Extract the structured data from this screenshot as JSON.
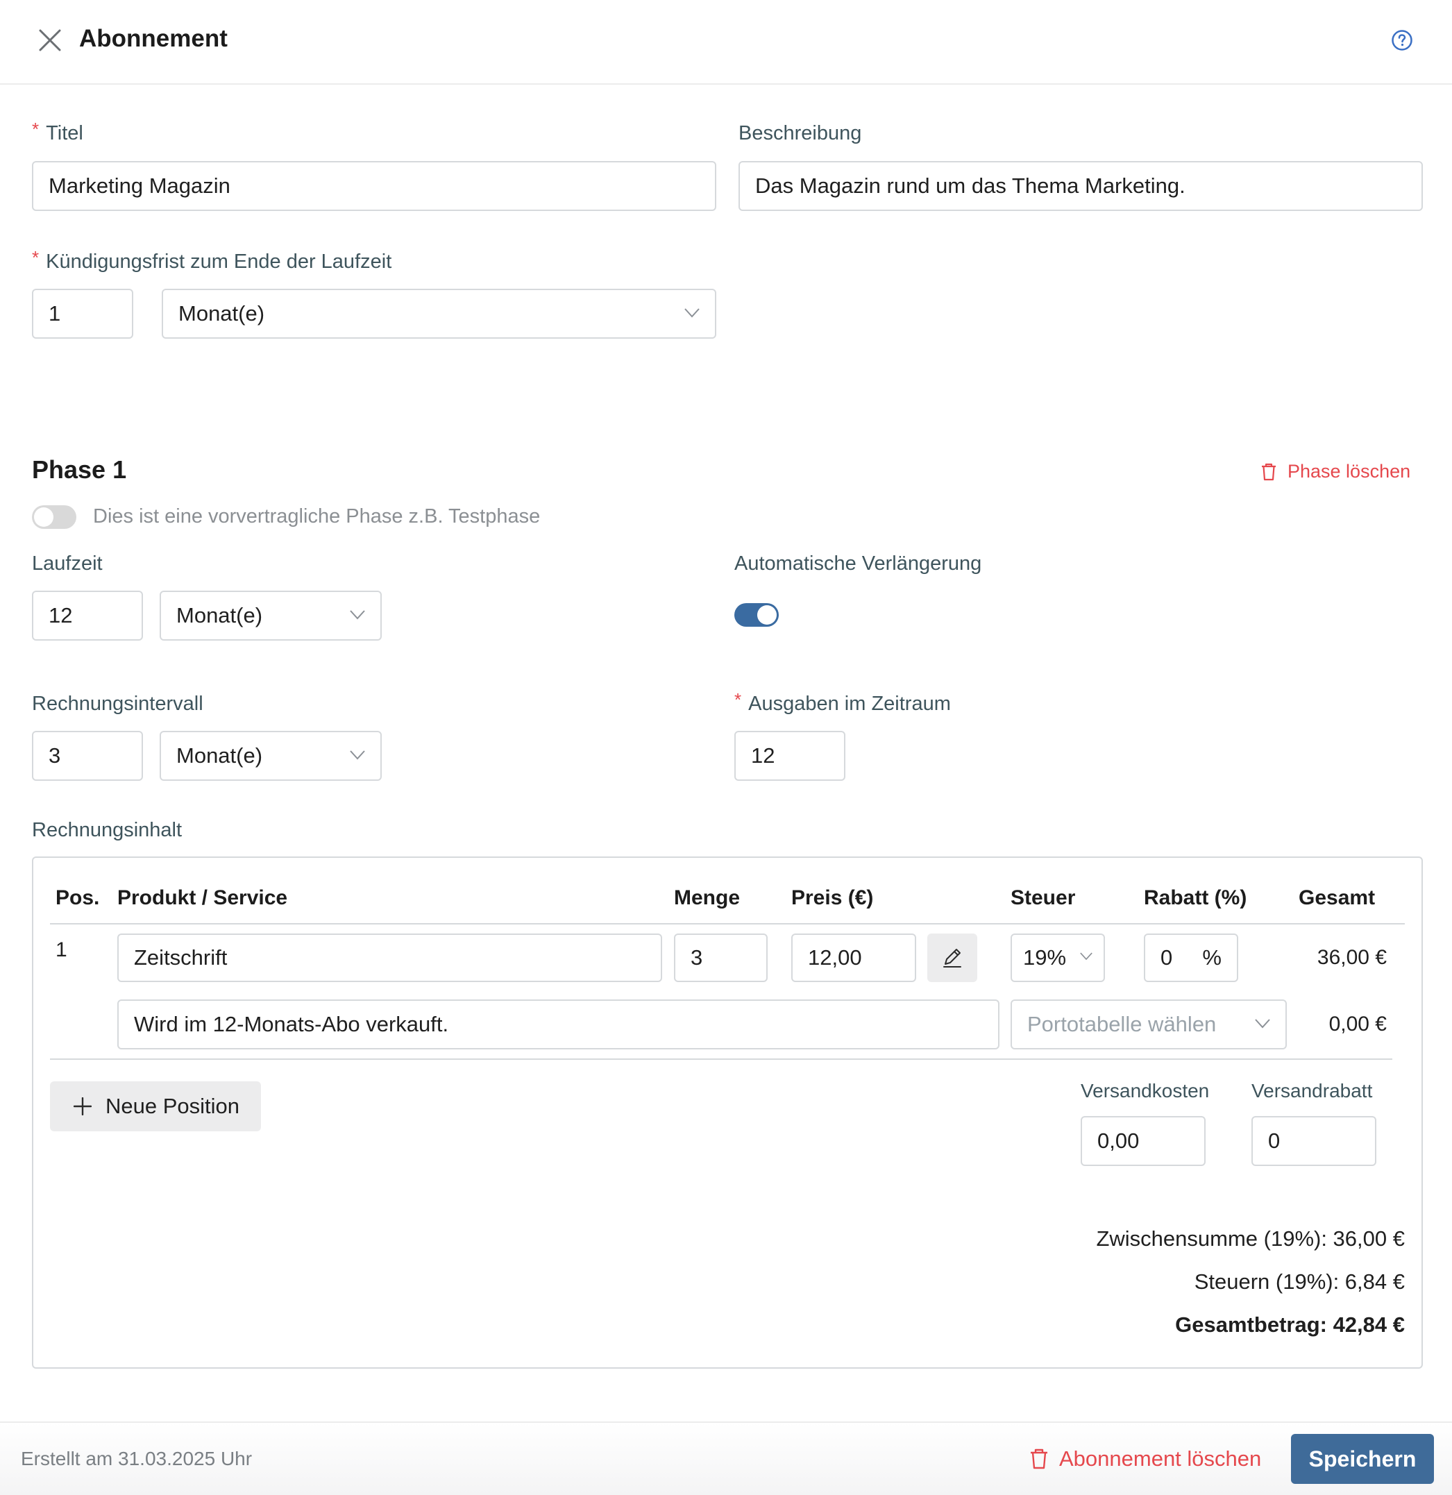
{
  "header": {
    "title": "Abonnement",
    "close_icon": "close-icon",
    "help_icon": "help-icon"
  },
  "form": {
    "titel": {
      "label": "Titel",
      "value": "Marketing Magazin",
      "required": true
    },
    "beschreibung": {
      "label": "Beschreibung",
      "value": "Das Magazin rund um das Thema Marketing."
    },
    "kuendigungsfrist": {
      "label": "Kündigungsfrist zum Ende der Laufzeit",
      "value": "1",
      "unit": "Monat(e)",
      "required": true
    }
  },
  "phase": {
    "title": "Phase 1",
    "delete_label": "Phase löschen",
    "precontract_toggle": {
      "label": "Dies ist eine vorvertragliche Phase z.B. Testphase",
      "on": false
    },
    "laufzeit": {
      "label": "Laufzeit",
      "value": "12",
      "unit": "Monat(e)"
    },
    "auto_renew": {
      "label": "Automatische Verlängerung",
      "on": true
    },
    "rechnungsintervall": {
      "label": "Rechnungsintervall",
      "value": "3",
      "unit": "Monat(e)"
    },
    "ausgaben": {
      "label": "Ausgaben im Zeitraum",
      "value": "12",
      "required": true
    }
  },
  "invoice": {
    "label": "Rechnungsinhalt",
    "headers": {
      "pos": "Pos.",
      "product": "Produkt / Service",
      "menge": "Menge",
      "preis": "Preis (€)",
      "steuer": "Steuer",
      "rabatt": "Rabatt (%)",
      "gesamt": "Gesamt"
    },
    "rows": [
      {
        "pos": "1",
        "product": "Zeitschrift",
        "menge": "3",
        "preis": "12,00",
        "steuer": "19%",
        "rabatt": "0",
        "rabatt_unit": "%",
        "gesamt": "36,00 €",
        "description": "Wird im 12-Monats-Abo verkauft.",
        "porto_placeholder": "Portotabelle wählen",
        "porto_total": "0,00 €"
      }
    ],
    "new_position_label": "Neue Position",
    "versandkosten": {
      "label": "Versandkosten",
      "value": "0,00"
    },
    "versandrabatt": {
      "label": "Versandrabatt",
      "value": "0"
    },
    "zwischensumme": "Zwischensumme (19%): 36,00 €",
    "steuern": "Steuern (19%): 6,84 €",
    "gesamtbetrag": "Gesamtbetrag: 42,84 €"
  },
  "footer": {
    "created": "Erstellt am 31.03.2025 Uhr",
    "delete_label": "Abonnement löschen",
    "save_label": "Speichern"
  },
  "colors": {
    "accent": "#3f6b99",
    "danger": "#e5484d",
    "toggle_on": "#3a6ba1",
    "label": "#3e545c"
  }
}
